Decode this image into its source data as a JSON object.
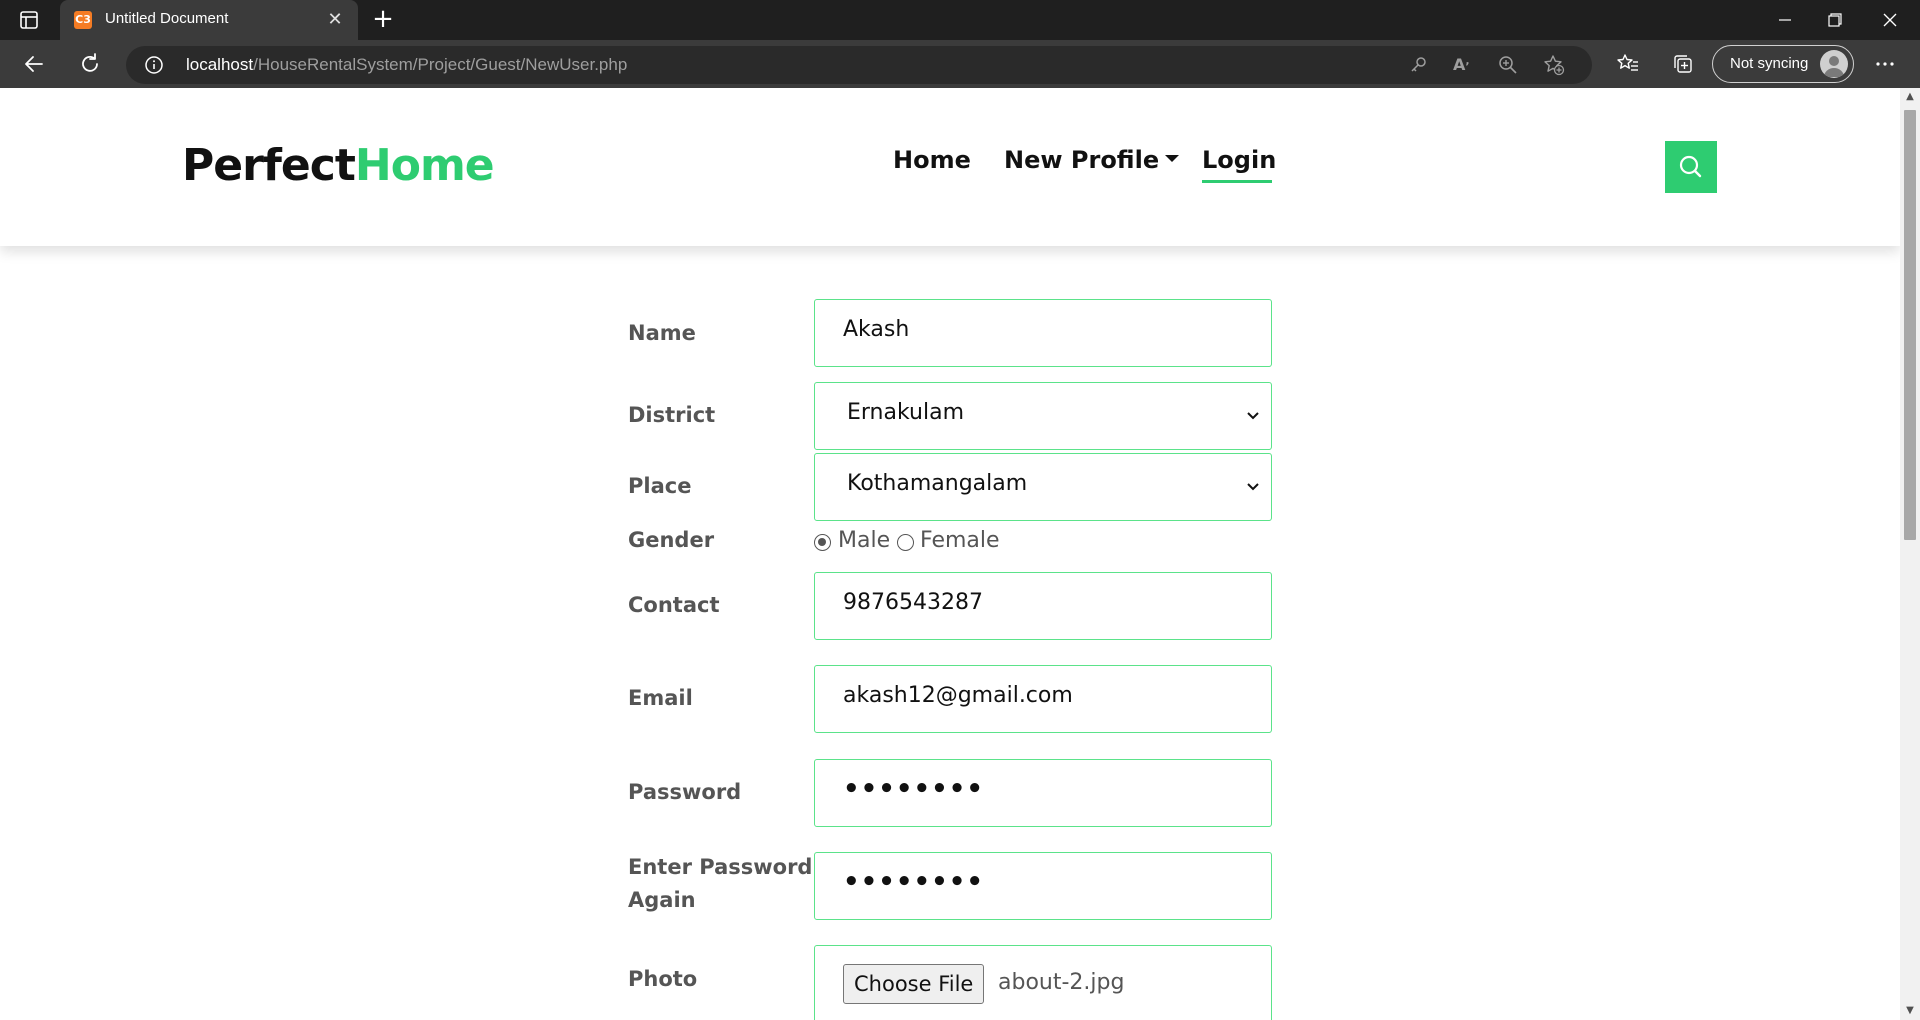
{
  "browser": {
    "tab_title": "Untitled Document",
    "favicon_text": "C3",
    "url_host": "localhost",
    "url_path": "/HouseRentalSystem/Project/Guest/NewUser.php",
    "sync_label": "Not syncing"
  },
  "site": {
    "logo_main": "Perfect",
    "logo_accent": "Home",
    "accent_color": "#2ecc71",
    "nav": {
      "home": "Home",
      "new_profile": "New Profile",
      "login": "Login"
    }
  },
  "form": {
    "name": {
      "label": "Name",
      "value": "Akash"
    },
    "district": {
      "label": "District",
      "value": "Ernakulam"
    },
    "place": {
      "label": "Place",
      "value": "Kothamangalam"
    },
    "gender": {
      "label": "Gender",
      "options": [
        "Male",
        "Female"
      ],
      "selected": "Male"
    },
    "contact": {
      "label": "Contact",
      "value": "9876543287"
    },
    "email": {
      "label": "Email",
      "value": "akash12@gmail.com"
    },
    "password": {
      "label": "Password",
      "masked": "••••••••"
    },
    "confirm_password": {
      "label_line1": "Enter Password",
      "label_line2": "Again",
      "masked": "••••••••"
    },
    "photo": {
      "label": "Photo",
      "button": "Choose File",
      "file_name": "about-2.jpg"
    }
  }
}
